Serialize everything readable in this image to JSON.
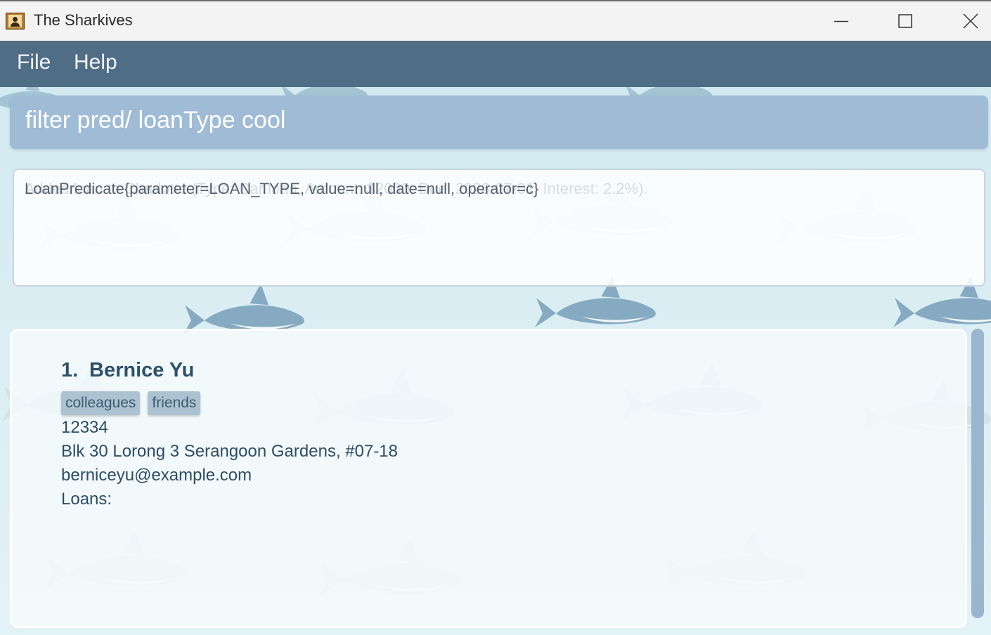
{
  "window": {
    "title": "The Sharkives"
  },
  "menu": {
    "items": [
      "File",
      "Help"
    ]
  },
  "command_box": {
    "value": "filter pred/ loanType cool"
  },
  "result_display": {
    "text": "LoanPredicate{parameter=LOAN_TYPE, value=null, date=null, operator=c}",
    "ghost_text": "Added loan to Charlotte (Type: Car loan, Amount: $2000, Due: 2026-07-01, Interest: 2.2%)."
  },
  "person_list": {
    "persons": [
      {
        "index": "1.",
        "name": "Bernice Yu",
        "tags": [
          "colleagues",
          "friends"
        ],
        "phone": "12334",
        "address": "Blk 30 Lorong 3 Serangoon Gardens, #07-18",
        "email": "berniceyu@example.com",
        "loans_label": "Loans:"
      }
    ]
  },
  "colors": {
    "menubar": "#506d86",
    "command_box": "#9fbbd5",
    "name_text": "#2f5069",
    "tag_bg": "#adc2d1",
    "scroll_thumb": "#9ab6cc"
  },
  "icons": {
    "app": "contact-book-icon",
    "minimize": "minimize-icon",
    "maximize": "maximize-icon",
    "close": "close-icon"
  }
}
